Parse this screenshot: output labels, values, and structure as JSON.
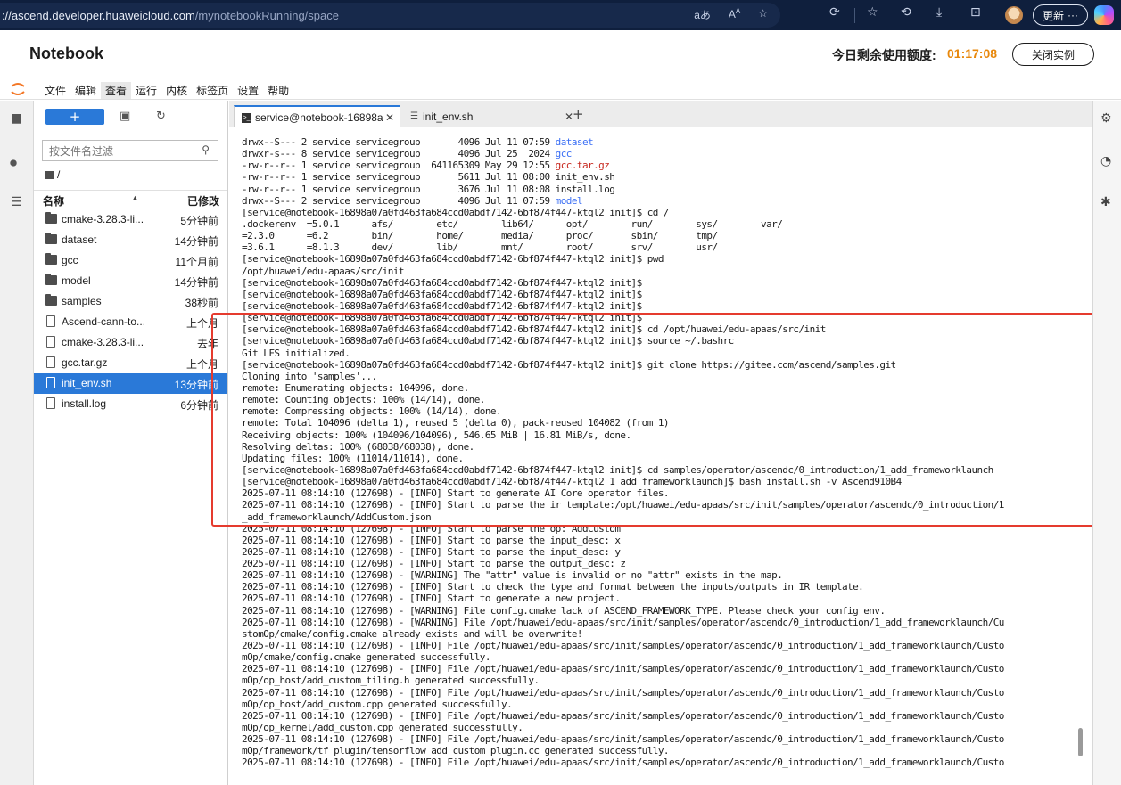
{
  "browser": {
    "url_host": "://ascend.developer.huaweicloud.com",
    "url_path": "/mynotebookRunning/space",
    "update_label": "更新",
    "more_label": "···",
    "icons": [
      "read-aloud-icon",
      "text-size-icon",
      "favorite-star-icon",
      "extensions-icon",
      "favorites-list-icon",
      "history-icon",
      "downloads-icon",
      "screenshot-icon",
      "profile-avatar",
      "copilot-icon"
    ]
  },
  "header": {
    "title": "Notebook",
    "quota_label": "今日剩余使用额度:",
    "quota_value": "01:17:08",
    "close_button": "关闭实例"
  },
  "menu": {
    "items": [
      "文件",
      "编辑",
      "查看",
      "运行",
      "内核",
      "标签页",
      "设置",
      "帮助"
    ],
    "active": "查看"
  },
  "file_browser": {
    "new_label": "+",
    "filter_placeholder": "按文件名过滤",
    "path": "/",
    "col_name": "名称",
    "col_modified": "已修改",
    "files": [
      {
        "name": "cmake-3.28.3-li...",
        "modified": "5分钟前",
        "type": "folder"
      },
      {
        "name": "dataset",
        "modified": "14分钟前",
        "type": "folder"
      },
      {
        "name": "gcc",
        "modified": "11个月前",
        "type": "folder"
      },
      {
        "name": "model",
        "modified": "14分钟前",
        "type": "folder"
      },
      {
        "name": "samples",
        "modified": "38秒前",
        "type": "folder"
      },
      {
        "name": "Ascend-cann-to...",
        "modified": "上个月",
        "type": "file"
      },
      {
        "name": "cmake-3.28.3-li...",
        "modified": "去年",
        "type": "file"
      },
      {
        "name": "gcc.tar.gz",
        "modified": "上个月",
        "type": "file"
      },
      {
        "name": "init_env.sh",
        "modified": "13分钟前",
        "type": "file",
        "selected": true
      },
      {
        "name": "install.log",
        "modified": "6分钟前",
        "type": "file"
      }
    ]
  },
  "tabs": [
    {
      "label": "service@notebook-16898a",
      "active": true
    },
    {
      "label": "init_env.sh",
      "active": false
    }
  ],
  "terminal": {
    "lines": [
      {
        "segments": [
          {
            "t": "drwx--S--- 2 service servicegroup       4096 Jul 11 07:59 "
          },
          {
            "t": "dataset",
            "c": "blue"
          }
        ]
      },
      {
        "segments": [
          {
            "t": "drwxr-s--- 8 service servicegroup       4096 Jul 25  2024 "
          },
          {
            "t": "gcc",
            "c": "blue"
          }
        ]
      },
      {
        "segments": [
          {
            "t": "-rw-r--r-- 1 service servicegroup  641165309 May 29 12:55 "
          },
          {
            "t": "gcc.tar.gz",
            "c": "red"
          }
        ]
      },
      {
        "segments": [
          {
            "t": "-rw-r--r-- 1 service servicegroup       5611 Jul 11 08:00 init_env.sh"
          }
        ]
      },
      {
        "segments": [
          {
            "t": "-rw-r--r-- 1 service servicegroup       3676 Jul 11 08:08 install.log"
          }
        ]
      },
      {
        "segments": [
          {
            "t": "drwx--S--- 2 service servicegroup       4096 Jul 11 07:59 "
          },
          {
            "t": "model",
            "c": "blue"
          }
        ]
      },
      {
        "segments": [
          {
            "t": "[service@notebook-16898a07a0fd463fa684ccd0abdf7142-6bf874f447-ktql2 init]$ cd /"
          }
        ]
      },
      {
        "segments": [
          {
            "t": ".dockerenv  =5.0.1      afs/        etc/        lib64/      opt/        run/        sys/        var/"
          }
        ]
      },
      {
        "segments": [
          {
            "t": "=2.3.0      =6.2        bin/        home/       media/      proc/       sbin/       tmp/"
          }
        ]
      },
      {
        "segments": [
          {
            "t": "=3.6.1      =8.1.3      dev/        lib/        mnt/        root/       srv/        usr/"
          }
        ]
      },
      {
        "segments": [
          {
            "t": "[service@notebook-16898a07a0fd463fa684ccd0abdf7142-6bf874f447-ktql2 init]$ pwd"
          }
        ]
      },
      {
        "segments": [
          {
            "t": "/opt/huawei/edu-apaas/src/init"
          }
        ]
      },
      {
        "segments": [
          {
            "t": "[service@notebook-16898a07a0fd463fa684ccd0abdf7142-6bf874f447-ktql2 init]$"
          }
        ]
      },
      {
        "segments": [
          {
            "t": "[service@notebook-16898a07a0fd463fa684ccd0abdf7142-6bf874f447-ktql2 init]$"
          }
        ]
      },
      {
        "segments": [
          {
            "t": "[service@notebook-16898a07a0fd463fa684ccd0abdf7142-6bf874f447-ktql2 init]$"
          }
        ]
      },
      {
        "segments": [
          {
            "t": "[service@notebook-16898a07a0fd463fa684ccd0abdf7142-6bf874f447-ktql2 init]$"
          }
        ]
      },
      {
        "segments": [
          {
            "t": "[service@notebook-16898a07a0fd463fa684ccd0abdf7142-6bf874f447-ktql2 init]$ cd /opt/huawei/edu-apaas/src/init"
          }
        ]
      },
      {
        "segments": [
          {
            "t": "[service@notebook-16898a07a0fd463fa684ccd0abdf7142-6bf874f447-ktql2 init]$ source ~/.bashrc"
          }
        ]
      },
      {
        "segments": [
          {
            "t": "Git LFS initialized."
          }
        ]
      },
      {
        "segments": [
          {
            "t": "[service@notebook-16898a07a0fd463fa684ccd0abdf7142-6bf874f447-ktql2 init]$ git clone https://gitee.com/ascend/samples.git"
          }
        ]
      },
      {
        "segments": [
          {
            "t": "Cloning into 'samples'..."
          }
        ]
      },
      {
        "segments": [
          {
            "t": "remote: Enumerating objects: 104096, done."
          }
        ]
      },
      {
        "segments": [
          {
            "t": "remote: Counting objects: 100% (14/14), done."
          }
        ]
      },
      {
        "segments": [
          {
            "t": "remote: Compressing objects: 100% (14/14), done."
          }
        ]
      },
      {
        "segments": [
          {
            "t": "remote: Total 104096 (delta 1), reused 5 (delta 0), pack-reused 104082 (from 1)"
          }
        ]
      },
      {
        "segments": [
          {
            "t": "Receiving objects: 100% (104096/104096), 546.65 MiB | 16.81 MiB/s, done."
          }
        ]
      },
      {
        "segments": [
          {
            "t": "Resolving deltas: 100% (68038/68038), done."
          }
        ]
      },
      {
        "segments": [
          {
            "t": "Updating files: 100% (11014/11014), done."
          }
        ]
      },
      {
        "segments": [
          {
            "t": "[service@notebook-16898a07a0fd463fa684ccd0abdf7142-6bf874f447-ktql2 init]$ cd samples/operator/ascendc/0_introduction/1_add_frameworklaunch"
          }
        ]
      },
      {
        "segments": [
          {
            "t": "[service@notebook-16898a07a0fd463fa684ccd0abdf7142-6bf874f447-ktql2 1_add_frameworklaunch]$ bash install.sh -v Ascend910B4"
          }
        ]
      },
      {
        "segments": [
          {
            "t": "2025-07-11 08:14:10 (127698) - [INFO] Start to generate AI Core operator files."
          }
        ]
      },
      {
        "segments": [
          {
            "t": "2025-07-11 08:14:10 (127698) - [INFO] Start to parse the ir template:/opt/huawei/edu-apaas/src/init/samples/operator/ascendc/0_introduction/1"
          }
        ]
      },
      {
        "segments": [
          {
            "t": "_add_frameworklaunch/AddCustom.json"
          }
        ]
      },
      {
        "segments": [
          {
            "t": "2025-07-11 08:14:10 (127698) - [INFO] Start to parse the op: AddCustom"
          }
        ]
      },
      {
        "segments": [
          {
            "t": "2025-07-11 08:14:10 (127698) - [INFO] Start to parse the input_desc: x"
          }
        ]
      },
      {
        "segments": [
          {
            "t": "2025-07-11 08:14:10 (127698) - [INFO] Start to parse the input_desc: y"
          }
        ]
      },
      {
        "segments": [
          {
            "t": "2025-07-11 08:14:10 (127698) - [INFO] Start to parse the output_desc: z"
          }
        ]
      },
      {
        "segments": [
          {
            "t": "2025-07-11 08:14:10 (127698) - [WARNING] The \"attr\" value is invalid or no \"attr\" exists in the map."
          }
        ]
      },
      {
        "segments": [
          {
            "t": "2025-07-11 08:14:10 (127698) - [INFO] Start to check the type and format between the inputs/outputs in IR template."
          }
        ]
      },
      {
        "segments": [
          {
            "t": "2025-07-11 08:14:10 (127698) - [INFO] Start to generate a new project."
          }
        ]
      },
      {
        "segments": [
          {
            "t": "2025-07-11 08:14:10 (127698) - [WARNING] File config.cmake lack of ASCEND_FRAMEWORK_TYPE. Please check your config env."
          }
        ]
      },
      {
        "segments": [
          {
            "t": "2025-07-11 08:14:10 (127698) - [WARNING] File /opt/huawei/edu-apaas/src/init/samples/operator/ascendc/0_introduction/1_add_frameworklaunch/Cu"
          }
        ]
      },
      {
        "segments": [
          {
            "t": "stomOp/cmake/config.cmake already exists and will be overwrite!"
          }
        ]
      },
      {
        "segments": [
          {
            "t": "2025-07-11 08:14:10 (127698) - [INFO] File /opt/huawei/edu-apaas/src/init/samples/operator/ascendc/0_introduction/1_add_frameworklaunch/Custo"
          }
        ]
      },
      {
        "segments": [
          {
            "t": "mOp/cmake/config.cmake generated successfully."
          }
        ]
      },
      {
        "segments": [
          {
            "t": "2025-07-11 08:14:10 (127698) - [INFO] File /opt/huawei/edu-apaas/src/init/samples/operator/ascendc/0_introduction/1_add_frameworklaunch/Custo"
          }
        ]
      },
      {
        "segments": [
          {
            "t": "mOp/op_host/add_custom_tiling.h generated successfully."
          }
        ]
      },
      {
        "segments": [
          {
            "t": "2025-07-11 08:14:10 (127698) - [INFO] File /opt/huawei/edu-apaas/src/init/samples/operator/ascendc/0_introduction/1_add_frameworklaunch/Custo"
          }
        ]
      },
      {
        "segments": [
          {
            "t": "mOp/op_host/add_custom.cpp generated successfully."
          }
        ]
      },
      {
        "segments": [
          {
            "t": "2025-07-11 08:14:10 (127698) - [INFO] File /opt/huawei/edu-apaas/src/init/samples/operator/ascendc/0_introduction/1_add_frameworklaunch/Custo"
          }
        ]
      },
      {
        "segments": [
          {
            "t": "mOp/op_kernel/add_custom.cpp generated successfully."
          }
        ]
      },
      {
        "segments": [
          {
            "t": "2025-07-11 08:14:10 (127698) - [INFO] File /opt/huawei/edu-apaas/src/init/samples/operator/ascendc/0_introduction/1_add_frameworklaunch/Custo"
          }
        ]
      },
      {
        "segments": [
          {
            "t": "mOp/framework/tf_plugin/tensorflow_add_custom_plugin.cc generated successfully."
          }
        ]
      },
      {
        "segments": [
          {
            "t": "2025-07-11 08:14:10 (127698) - [INFO] File /opt/huawei/edu-apaas/src/init/samples/operator/ascendc/0_introduction/1_add_frameworklaunch/Custo"
          }
        ]
      }
    ]
  },
  "colors": {
    "accent": "#2a79d8",
    "quota": "#e8880c",
    "dir": "#3b6ff5",
    "archive": "#c7281f",
    "annotation": "#e53b2e"
  }
}
